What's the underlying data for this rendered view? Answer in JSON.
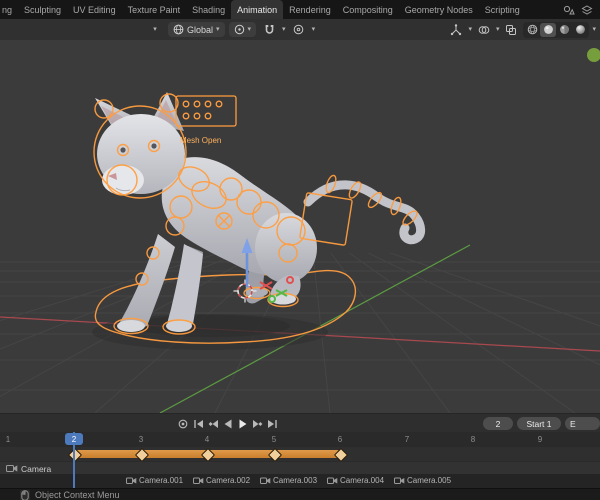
{
  "topbar": {
    "tabs": [
      "ng",
      "Sculpting",
      "UV Editing",
      "Texture Paint",
      "Shading",
      "Animation",
      "Rendering",
      "Compositing",
      "Geometry Nodes",
      "Scripting"
    ]
  },
  "viewport_header": {
    "orientation_label": "Global"
  },
  "viewport": {
    "rig_panel_label": "Mesh Open"
  },
  "playback": {
    "current_frame": "2",
    "start_field": "Start 1",
    "end_field_partial": "E"
  },
  "timeline": {
    "ruler": [
      "1",
      "2",
      "3",
      "4",
      "5",
      "6",
      "7",
      "8",
      "9"
    ],
    "playhead_frame": "2",
    "channel_label": "Camera",
    "markers": [
      "Camera.001",
      "Camera.002",
      "Camera.003",
      "Camera.004",
      "Camera.005"
    ]
  },
  "status_bar": {
    "hint": "Object Context Menu"
  },
  "icons": {
    "chevron": "▾"
  },
  "colors": {
    "accent_orange": "#e0902f",
    "playhead_blue": "#4d79bd",
    "axis_red": "#a8494f",
    "axis_green": "#5c9b43",
    "armature_orange": "#ff9d3f"
  }
}
